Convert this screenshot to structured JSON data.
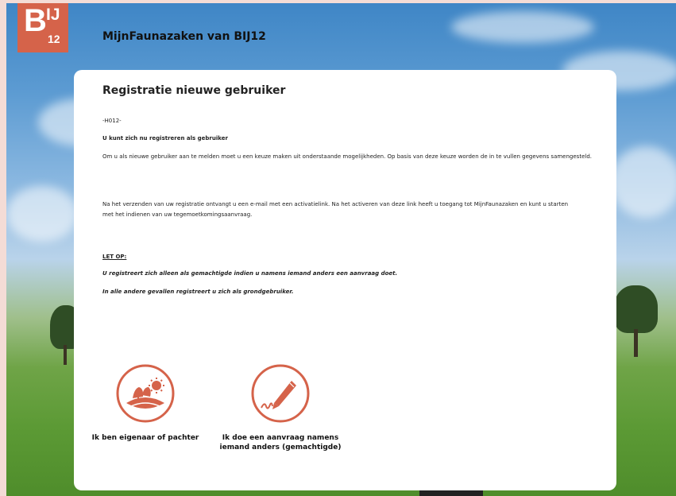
{
  "header": {
    "logo": {
      "letter": "B",
      "superscript": "IJ",
      "subscript": "12",
      "color": "#d5634a"
    },
    "site_title": "MijnFaunazaken van BIJ12"
  },
  "card": {
    "title": "Registratie nieuwe gebruiker",
    "code": "-H012-",
    "subheading": "U kunt zich nu registreren als gebruiker",
    "paragraph1": "Om u als nieuwe gebruiker aan te melden moet u een keuze maken uit onderstaande mogelijkheden. Op basis van deze keuze worden de in te vullen gegevens samengesteld.",
    "paragraph2": "Na het verzenden van uw registratie ontvangt u een e-mail met een activatielink. Na het activeren van deze link heeft u toegang tot MijnFaunazaken en kunt u starten met het indienen van uw tegemoetkomingsaanvraag.",
    "notice_title": "LET OP:",
    "notice_line1": "U registreert zich alleen als gemachtigde indien u namens iemand anders een aanvraag doet.",
    "notice_line2": "In alle andere gevallen registreert u zich als grondgebruiker."
  },
  "choices": [
    {
      "label": "Ik ben eigenaar of pachter",
      "icon": "land-owner-icon"
    },
    {
      "label": "Ik doe een aanvraag namens iemand anders (gemachtigde)",
      "icon": "pen-signature-icon"
    }
  ],
  "colors": {
    "accent": "#d5634a"
  }
}
